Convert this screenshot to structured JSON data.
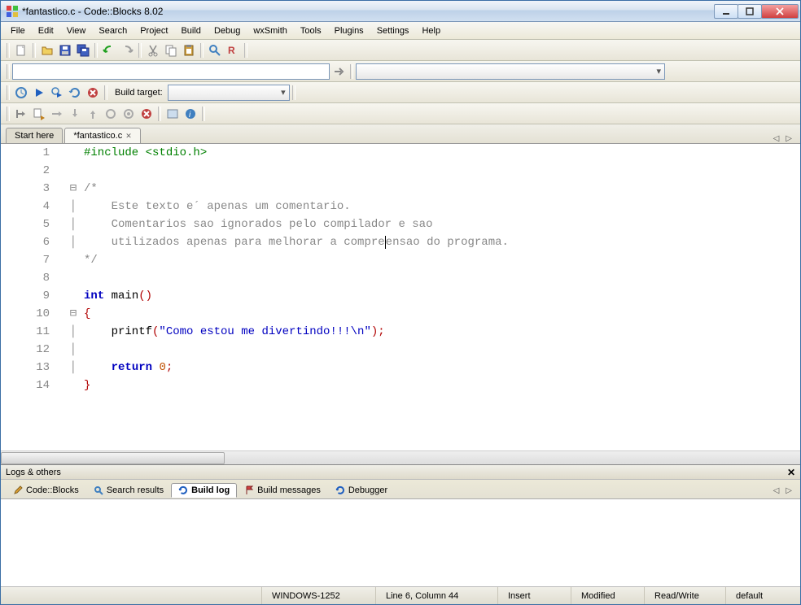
{
  "window": {
    "title": "*fantastico.c - Code::Blocks 8.02"
  },
  "menubar": [
    "File",
    "Edit",
    "View",
    "Search",
    "Project",
    "Build",
    "Debug",
    "wxSmith",
    "Tools",
    "Plugins",
    "Settings",
    "Help"
  ],
  "toolbar2": {
    "build_target_label": "Build target:",
    "build_target_value": ""
  },
  "tabs": [
    {
      "label": "Start here",
      "active": false,
      "closable": false
    },
    {
      "label": "*fantastico.c",
      "active": true,
      "closable": true
    }
  ],
  "code": {
    "lines": [
      {
        "n": 1,
        "fold": "",
        "tokens": [
          [
            "pp",
            "#include <stdio.h>"
          ]
        ]
      },
      {
        "n": 2,
        "fold": "",
        "tokens": []
      },
      {
        "n": 3,
        "fold": "⊟",
        "tokens": [
          [
            "cm",
            "/*"
          ]
        ]
      },
      {
        "n": 4,
        "fold": "│",
        "tokens": [
          [
            "cm",
            "    Este texto e´ apenas um comentario."
          ]
        ]
      },
      {
        "n": 5,
        "fold": "│",
        "tokens": [
          [
            "cm",
            "    Comentarios sao ignorados pelo compilador e sao"
          ]
        ]
      },
      {
        "n": 6,
        "fold": "│",
        "tokens": [
          [
            "cm",
            "    utilizados apenas para melhorar a compre"
          ],
          [
            "caret",
            ""
          ],
          [
            "cm",
            "ensao do programa."
          ]
        ]
      },
      {
        "n": 7,
        "fold": "",
        "tokens": [
          [
            "cm",
            "*/"
          ]
        ]
      },
      {
        "n": 8,
        "fold": "",
        "tokens": []
      },
      {
        "n": 9,
        "fold": "",
        "tokens": [
          [
            "kw",
            "int"
          ],
          [
            "",
            " main"
          ],
          [
            "sym",
            "()"
          ]
        ]
      },
      {
        "n": 10,
        "fold": "⊟",
        "tokens": [
          [
            "sym",
            "{"
          ]
        ]
      },
      {
        "n": 11,
        "fold": "│",
        "tokens": [
          [
            "",
            "    printf"
          ],
          [
            "sym",
            "("
          ],
          [
            "str",
            "\"Como estou me divertindo!!!\\n\""
          ],
          [
            "sym",
            ")"
          ],
          [
            "sym",
            ";"
          ]
        ]
      },
      {
        "n": 12,
        "fold": "│",
        "tokens": []
      },
      {
        "n": 13,
        "fold": "│",
        "tokens": [
          [
            "",
            "    "
          ],
          [
            "kw",
            "return"
          ],
          [
            "",
            " "
          ],
          [
            "num",
            "0"
          ],
          [
            "sym",
            ";"
          ]
        ]
      },
      {
        "n": 14,
        "fold": "",
        "tokens": [
          [
            "sym",
            "}"
          ]
        ]
      }
    ]
  },
  "logs": {
    "title": "Logs & others",
    "tabs": [
      {
        "label": "Code::Blocks",
        "icon": "pencil",
        "active": false
      },
      {
        "label": "Search results",
        "icon": "search",
        "active": false
      },
      {
        "label": "Build log",
        "icon": "refresh",
        "active": true
      },
      {
        "label": "Build messages",
        "icon": "flag",
        "active": false
      },
      {
        "label": "Debugger",
        "icon": "refresh",
        "active": false
      }
    ]
  },
  "statusbar": {
    "encoding": "WINDOWS-1252",
    "position": "Line 6, Column 44",
    "insert_mode": "Insert",
    "modified": "Modified",
    "readwrite": "Read/Write",
    "profile": "default"
  }
}
